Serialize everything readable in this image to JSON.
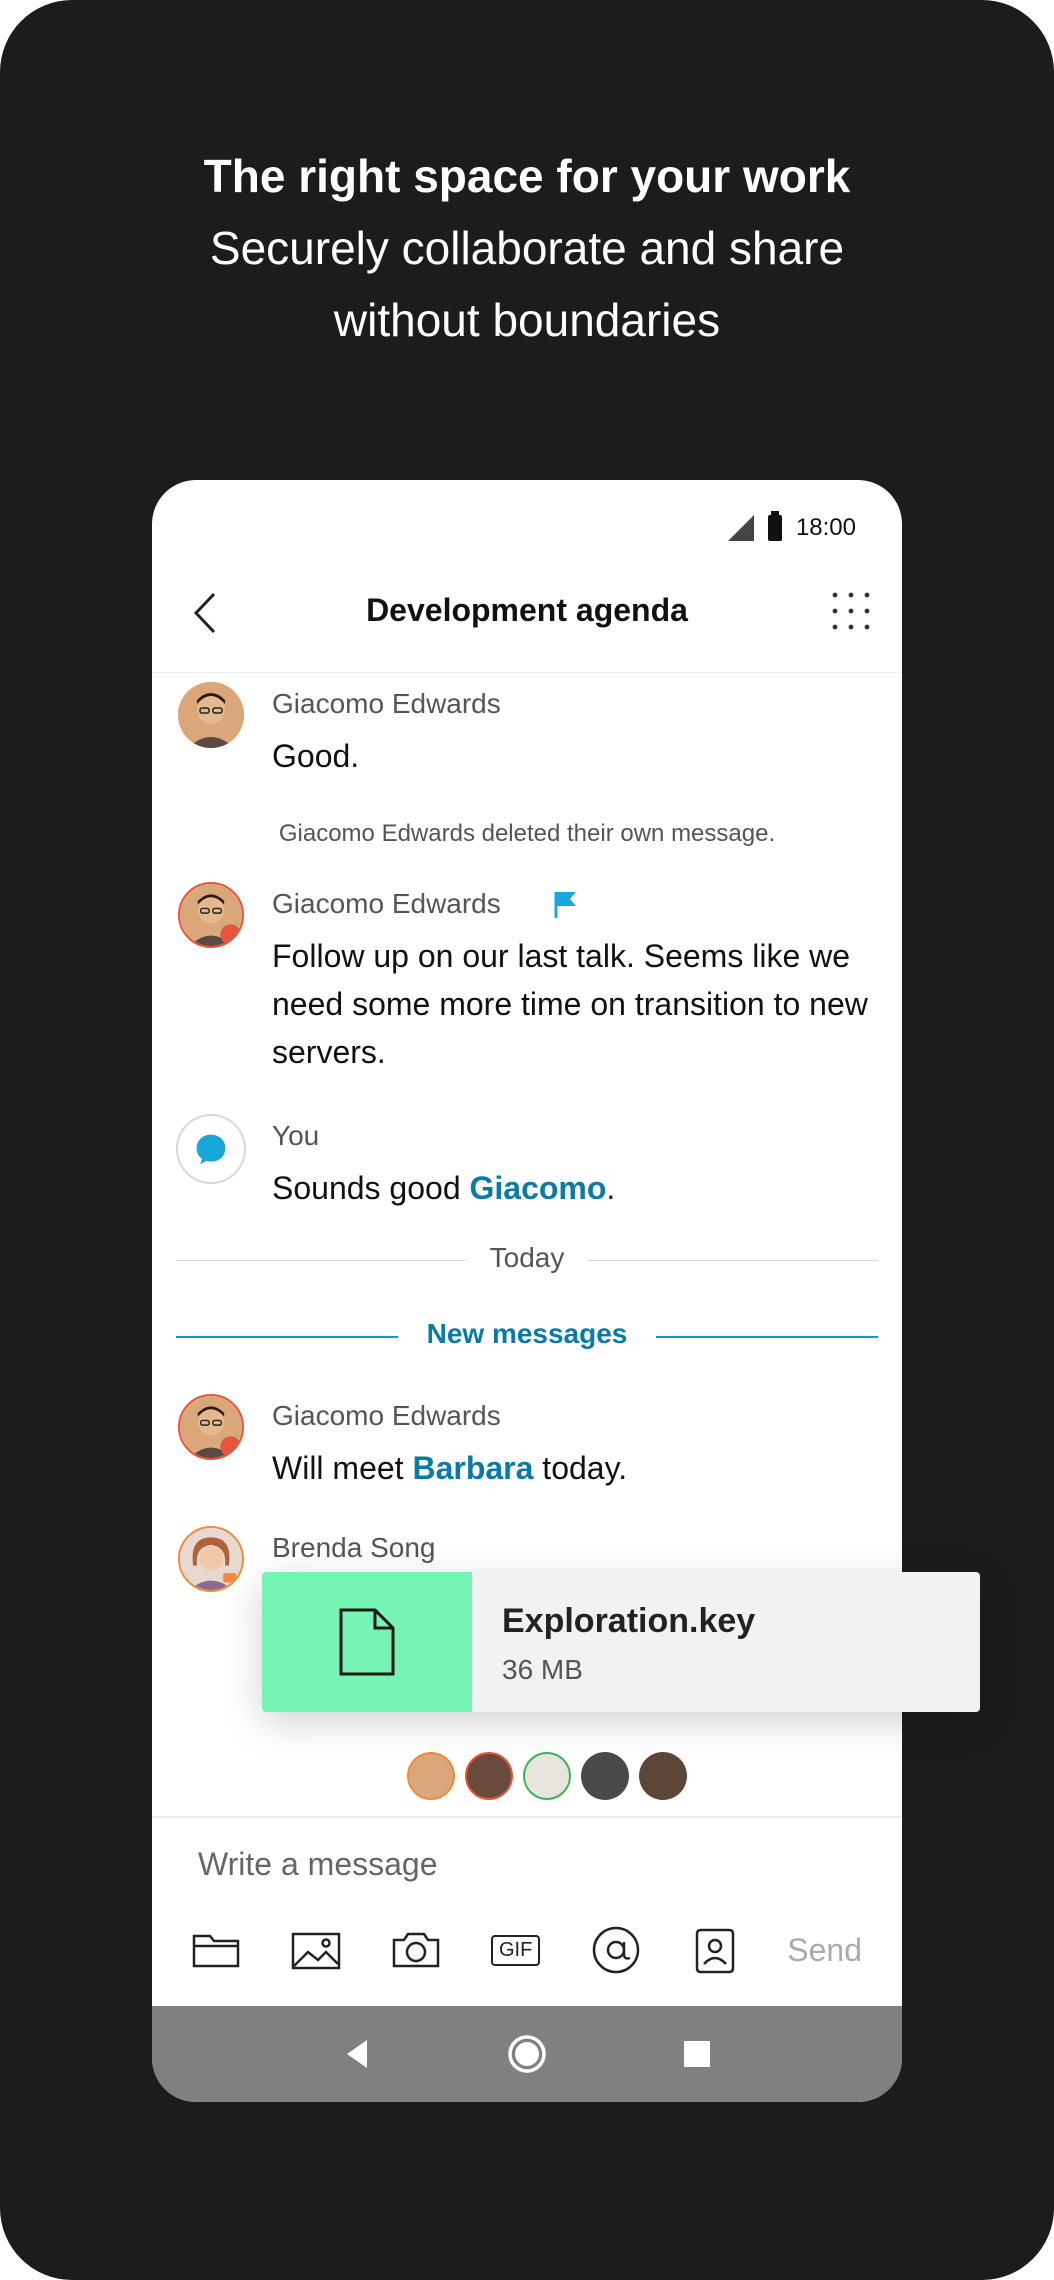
{
  "hero": {
    "line1": "The right space for your work",
    "line2": "Securely collaborate and share",
    "line3": "without boundaries"
  },
  "status": {
    "time": "18:00"
  },
  "header": {
    "title": "Development agenda"
  },
  "messages": [
    {
      "name": "Giacomo Edwards",
      "text": "Good."
    },
    {
      "system": "Giacomo Edwards deleted their own message."
    },
    {
      "name": "Giacomo Edwards",
      "text": "Follow up on our last talk. Seems like we need some more time on transition to new servers."
    },
    {
      "name": "You",
      "text_before": "Sounds good ",
      "mention": "Giacomo",
      "text_after": "."
    },
    {
      "name": "Giacomo Edwards",
      "text_before": "Will meet ",
      "mention": "Barbara",
      "text_after": " today."
    },
    {
      "name": "Brenda Song"
    }
  ],
  "dividers": {
    "today": "Today",
    "new_messages": "New messages"
  },
  "file": {
    "name": "Exploration.key",
    "size": "36 MB"
  },
  "composer": {
    "placeholder": "Write a message",
    "send_label": "Send",
    "gif_label": "GIF"
  },
  "colors": {
    "accent": "#0a7aa6",
    "file_thumb": "#76f4b4",
    "divider_blue": "#0a9bd0",
    "flag": "#1aa7e0"
  }
}
